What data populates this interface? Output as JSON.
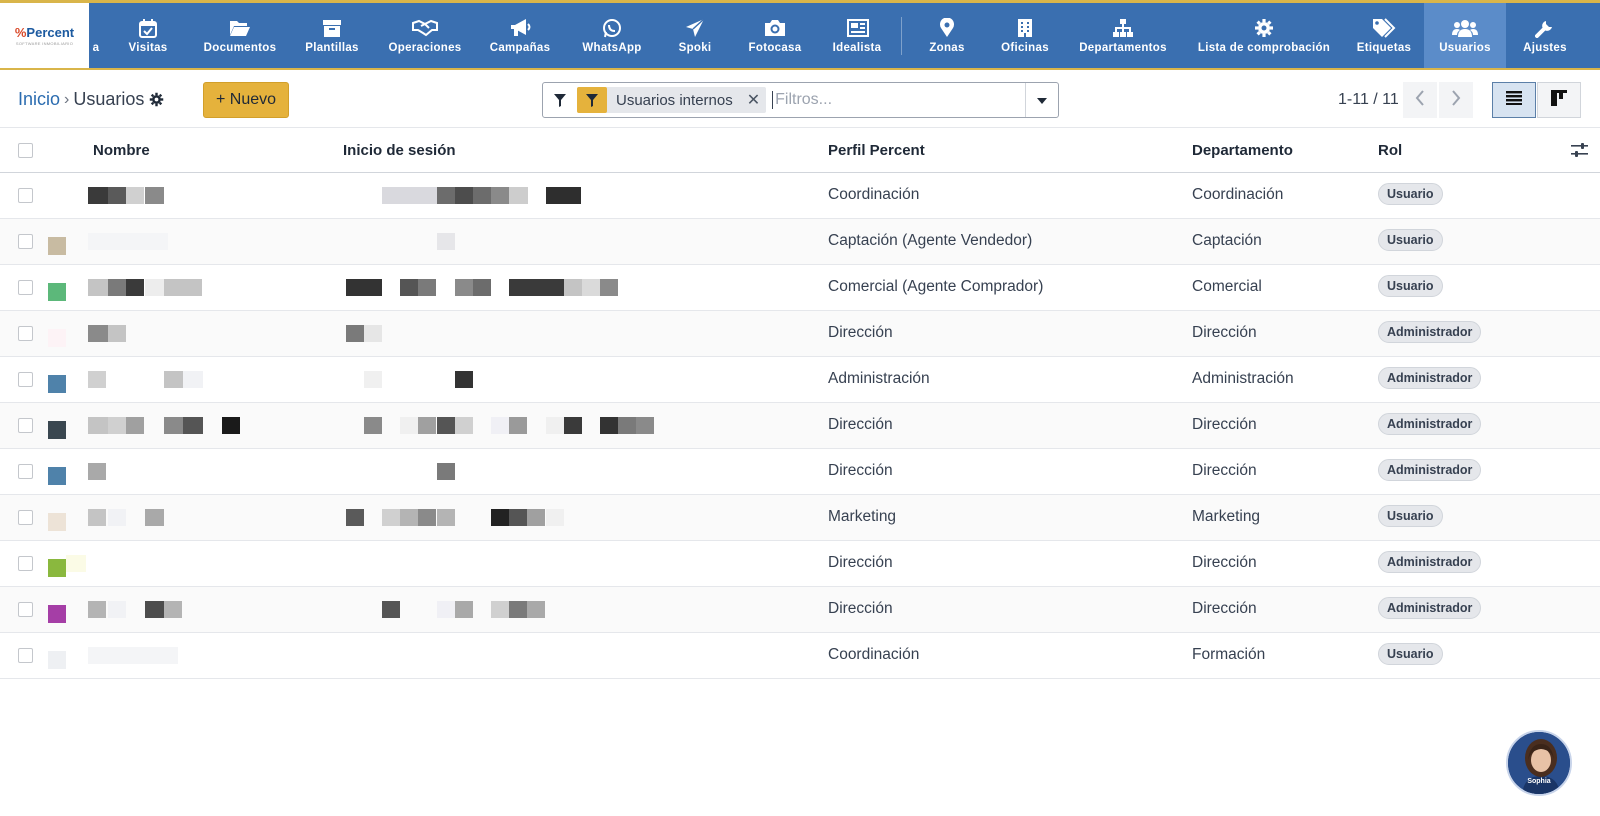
{
  "app": {
    "logo_text": "Percent",
    "logo_tagline": "SOFTWARE INMOBILIARIO"
  },
  "nav": {
    "items": [
      {
        "label": "a",
        "icon": "calendar-icon"
      },
      {
        "label": "Visitas",
        "icon": "calendar-check-icon"
      },
      {
        "label": "Documentos",
        "icon": "folder-open-icon"
      },
      {
        "label": "Plantillas",
        "icon": "archive-icon"
      },
      {
        "label": "Operaciones",
        "icon": "handshake-icon"
      },
      {
        "label": "Campañas",
        "icon": "megaphone-icon"
      },
      {
        "label": "WhatsApp",
        "icon": "whatsapp-icon"
      },
      {
        "label": "Spoki",
        "icon": "paper-plane-icon"
      },
      {
        "label": "Fotocasa",
        "icon": "camera-icon"
      },
      {
        "label": "Idealista",
        "icon": "newspaper-icon"
      },
      {
        "label": "Zonas",
        "icon": "map-pin-icon"
      },
      {
        "label": "Oficinas",
        "icon": "building-icon"
      },
      {
        "label": "Departamentos",
        "icon": "sitemap-icon"
      },
      {
        "label": "Lista de comprobación",
        "icon": "gear-icon"
      },
      {
        "label": "Etiquetas",
        "icon": "tags-icon"
      },
      {
        "label": "Usuarios",
        "icon": "users-icon"
      },
      {
        "label": "Ajustes",
        "icon": "wrench-icon"
      }
    ],
    "active": "Usuarios"
  },
  "breadcrumb": {
    "home": "Inicio",
    "separator": "›",
    "current": "Usuarios"
  },
  "toolbar": {
    "new_label": "+ Nuevo"
  },
  "search": {
    "facet_label": "Usuarios internos",
    "facet_close": "✕",
    "placeholder": "Filtros..."
  },
  "pager": {
    "text": "1-11 / 11"
  },
  "table": {
    "headers": {
      "name": "Nombre",
      "login": "Inicio de sesión",
      "profile": "Perfil Percent",
      "department": "Departamento",
      "role": "Rol"
    },
    "rows": [
      {
        "profile": "Coordinación",
        "department": "Coordinación",
        "role": "Usuario",
        "swatch": "#ffffff"
      },
      {
        "profile": "Captación (Agente Vendedor)",
        "department": "Captación",
        "role": "Usuario",
        "swatch": "#c8bba2"
      },
      {
        "profile": "Comercial (Agente Comprador)",
        "department": "Comercial",
        "role": "Usuario",
        "swatch": "#5cb87a"
      },
      {
        "profile": "Dirección",
        "department": "Dirección",
        "role": "Administrador",
        "swatch": "#fdf3f6"
      },
      {
        "profile": "Administración",
        "department": "Administración",
        "role": "Administrador",
        "swatch": "#4f82aa"
      },
      {
        "profile": "Dirección",
        "department": "Dirección",
        "role": "Administrador",
        "swatch": "#3a4750"
      },
      {
        "profile": "Dirección",
        "department": "Dirección",
        "role": "Administrador",
        "swatch": "#4f82aa"
      },
      {
        "profile": "Marketing",
        "department": "Marketing",
        "role": "Usuario",
        "swatch": "#ede3d7"
      },
      {
        "profile": "Dirección",
        "department": "Dirección",
        "role": "Administrador",
        "swatch": "#8ab83e"
      },
      {
        "profile": "Dirección",
        "department": "Dirección",
        "role": "Administrador",
        "swatch": "#a53ea6"
      },
      {
        "profile": "Coordinación",
        "department": "Formación",
        "role": "Usuario",
        "swatch": "#eef0f3"
      }
    ]
  },
  "assistant": {
    "name": "Sophia"
  },
  "colors": {
    "nav_bg": "#3a6fb0",
    "nav_accent": "#d9b54a",
    "new_button": "#e5b23c",
    "link": "#2b6cb0"
  }
}
